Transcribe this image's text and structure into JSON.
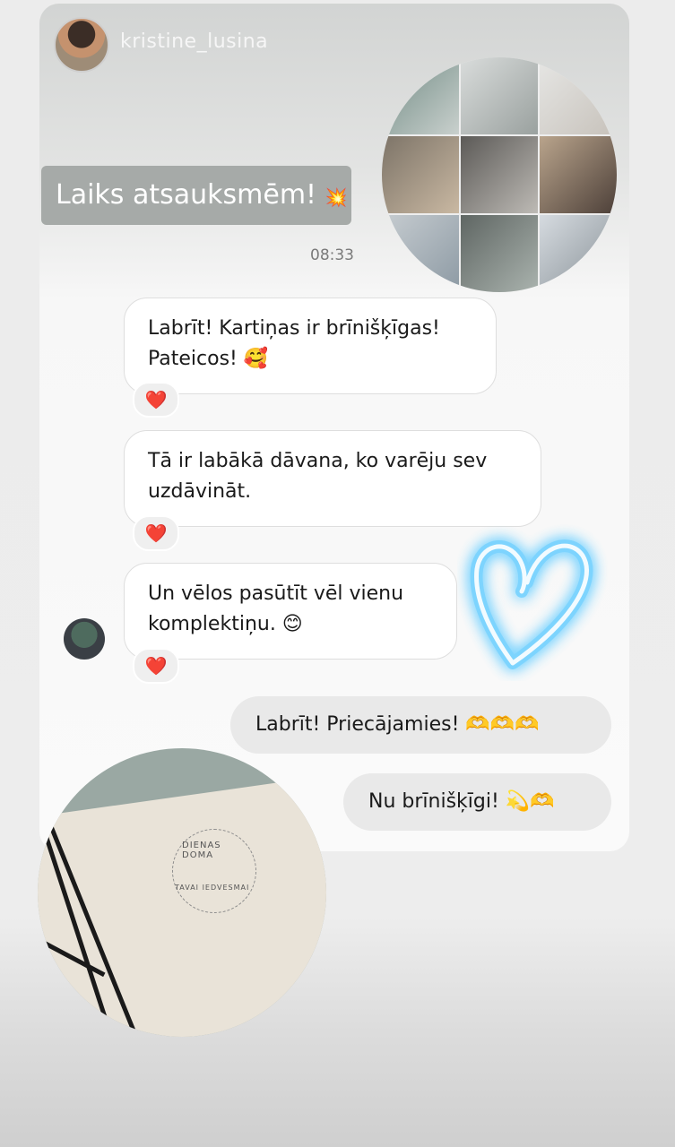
{
  "header": {
    "username": "kristine_lusina"
  },
  "story": {
    "label": "Laiks atsauksmēm!",
    "label_emoji": "💥"
  },
  "thread": {
    "time": "08:33",
    "incoming": [
      {
        "line1": "Labrīt! Kartiņas ir brīnišķīgas!",
        "line2": "Pateicos! 🥰",
        "reaction": "❤️"
      },
      {
        "line1": "Tā ir labākā dāvana, ko varēju sev",
        "line2": "uzdāvināt.",
        "reaction": "❤️"
      },
      {
        "line1": "Un vēlos pasūtīt vēl vienu",
        "line2": "komplektiņu. 😊",
        "reaction": "❤️"
      }
    ],
    "outgoing": [
      {
        "text": "Labrīt! Priecājamies! 🫶🫶🫶"
      },
      {
        "text": "Nu brīnišķīgi! 💫🫶"
      }
    ]
  },
  "product": {
    "stamp_top": "DIENAS DOMA",
    "stamp_bottom": "TAVAI IEDVESMAI"
  },
  "colors": {
    "heart_glow": "#6fd0ff",
    "reaction_heart": "#e0202c"
  }
}
